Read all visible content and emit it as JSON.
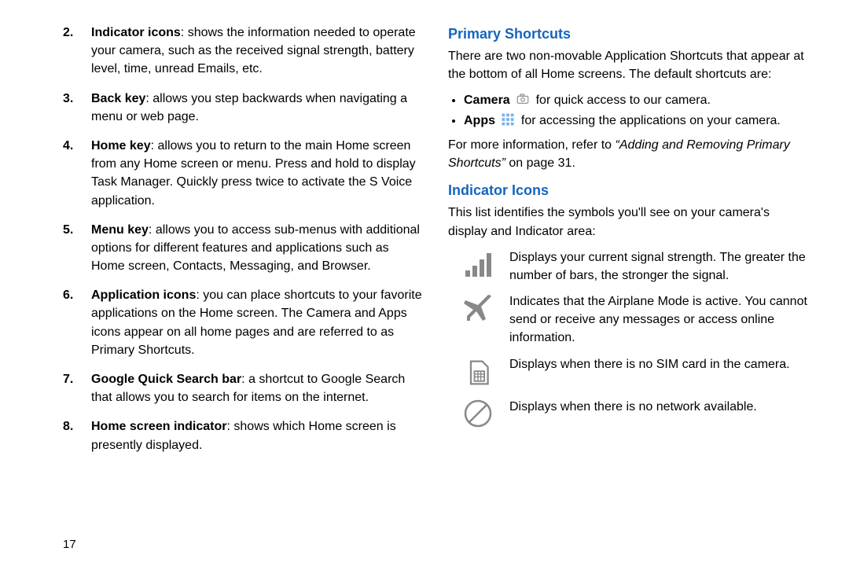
{
  "left": {
    "items": [
      {
        "term": "Indicator icons",
        "desc": ": shows the information needed to operate your camera, such as the received signal strength, battery level, time, unread Emails, etc."
      },
      {
        "term": "Back key",
        "desc": ": allows you step backwards when navigating a menu or web page."
      },
      {
        "term": "Home key",
        "desc": ": allows you to return to the main Home screen from any Home screen or menu. Press and hold to display Task Manager. Quickly press twice to activate the S Voice application."
      },
      {
        "term": "Menu key",
        "desc": ": allows you to access sub-menus with additional options for different features and applications such as Home screen, Contacts, Messaging, and Browser."
      },
      {
        "term": "Application icons",
        "desc": ": you can place shortcuts to your favorite applications on the Home screen. The Camera and Apps icons appear on all home pages and are referred to as Primary Shortcuts."
      },
      {
        "term": "Google Quick Search bar",
        "desc": ": a shortcut to Google Search that allows you to search for items on the internet."
      },
      {
        "term": "Home screen indicator",
        "desc": ": shows which Home screen is presently displayed."
      }
    ],
    "pageno": "17"
  },
  "right": {
    "primary_heading": "Primary Shortcuts",
    "primary_intro": "There are two non-movable Application Shortcuts that appear at the bottom of all Home screens. The default shortcuts are:",
    "bullets": [
      {
        "bold": "Camera",
        "trail": "for quick access to our camera."
      },
      {
        "bold": "Apps",
        "trail": "for accessing the applications on your camera."
      }
    ],
    "more_info_pre": "For more information, refer to ",
    "more_info_ital": "“Adding and Removing Primary Shortcuts”",
    "more_info_post": "  on page 31.",
    "indicator_heading": "Indicator Icons",
    "indicator_intro": "This list identifies the symbols you'll see on your camera's display and Indicator area:",
    "rows": [
      {
        "desc": "Displays your current signal strength. The greater the number of bars, the stronger the signal."
      },
      {
        "desc": "Indicates that the Airplane Mode is active. You cannot send or receive any messages or access online information."
      },
      {
        "desc": "Displays when there is no SIM card in the camera."
      },
      {
        "desc": "Displays when there is no network available."
      }
    ]
  }
}
